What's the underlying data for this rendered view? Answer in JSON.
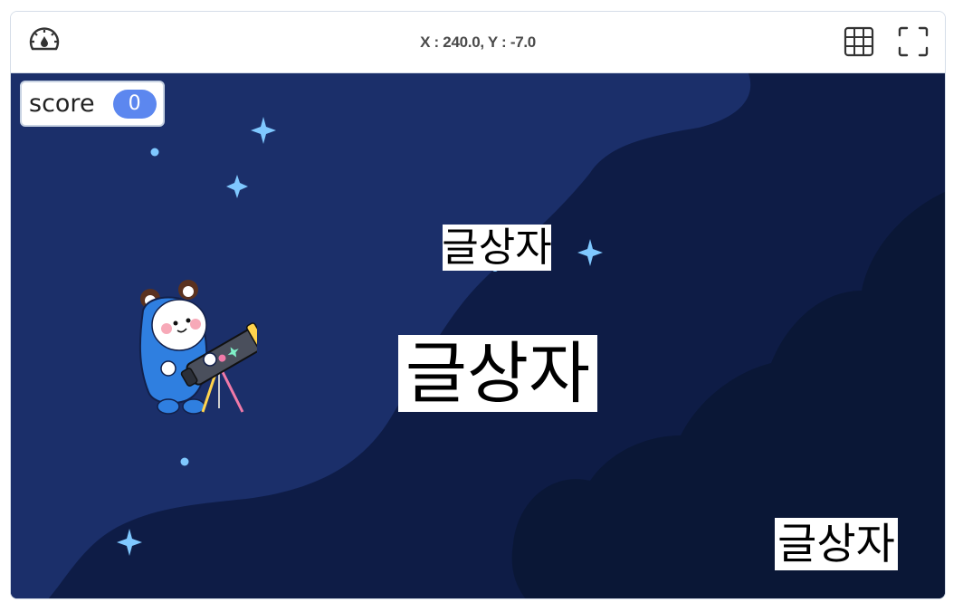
{
  "toolbar": {
    "speed_icon": "speedometer-icon",
    "coordinates": "X : 240.0, Y : -7.0",
    "grid_icon": "grid-icon",
    "fullscreen_icon": "fullscreen-icon"
  },
  "monitor": {
    "label": "score",
    "value": "0"
  },
  "sprites": {
    "text1": "글상자",
    "text2": "글상자",
    "text3": "글상자",
    "character": "astronaut-with-telescope"
  },
  "colors": {
    "stage_bg": "#0d1b43",
    "monitor_badge": "#5c87ef",
    "stars": "#7fc8ff"
  }
}
